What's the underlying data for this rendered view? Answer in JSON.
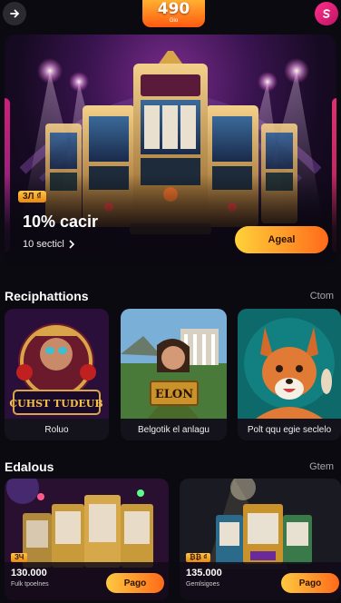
{
  "header": {
    "balance": "490",
    "balance_label": "Gio"
  },
  "hero": {
    "badge": "3Л ₫",
    "title": "10% cacir",
    "subtitle": "10 secticl",
    "cta": "Ageal"
  },
  "recommendations": {
    "title": "Reciphattions",
    "link": "Ctom",
    "cards": [
      {
        "caption": "Roluo",
        "art_text": "CUHST TUDEUB"
      },
      {
        "caption": "Belgotik el anlagu",
        "art_text": "ELON"
      },
      {
        "caption": "Polt qqu egie seclelo"
      }
    ]
  },
  "promos": {
    "title": "Edalous",
    "link": "Gtem",
    "cards": [
      {
        "badge": "ЗЧ",
        "amount": "130.000",
        "sub": "Fulk tpoelnes",
        "button": "Pago"
      },
      {
        "badge": "₿₿ ₫",
        "amount": "135.000",
        "sub": "Gemlsigoes",
        "button": "Pago"
      }
    ]
  }
}
